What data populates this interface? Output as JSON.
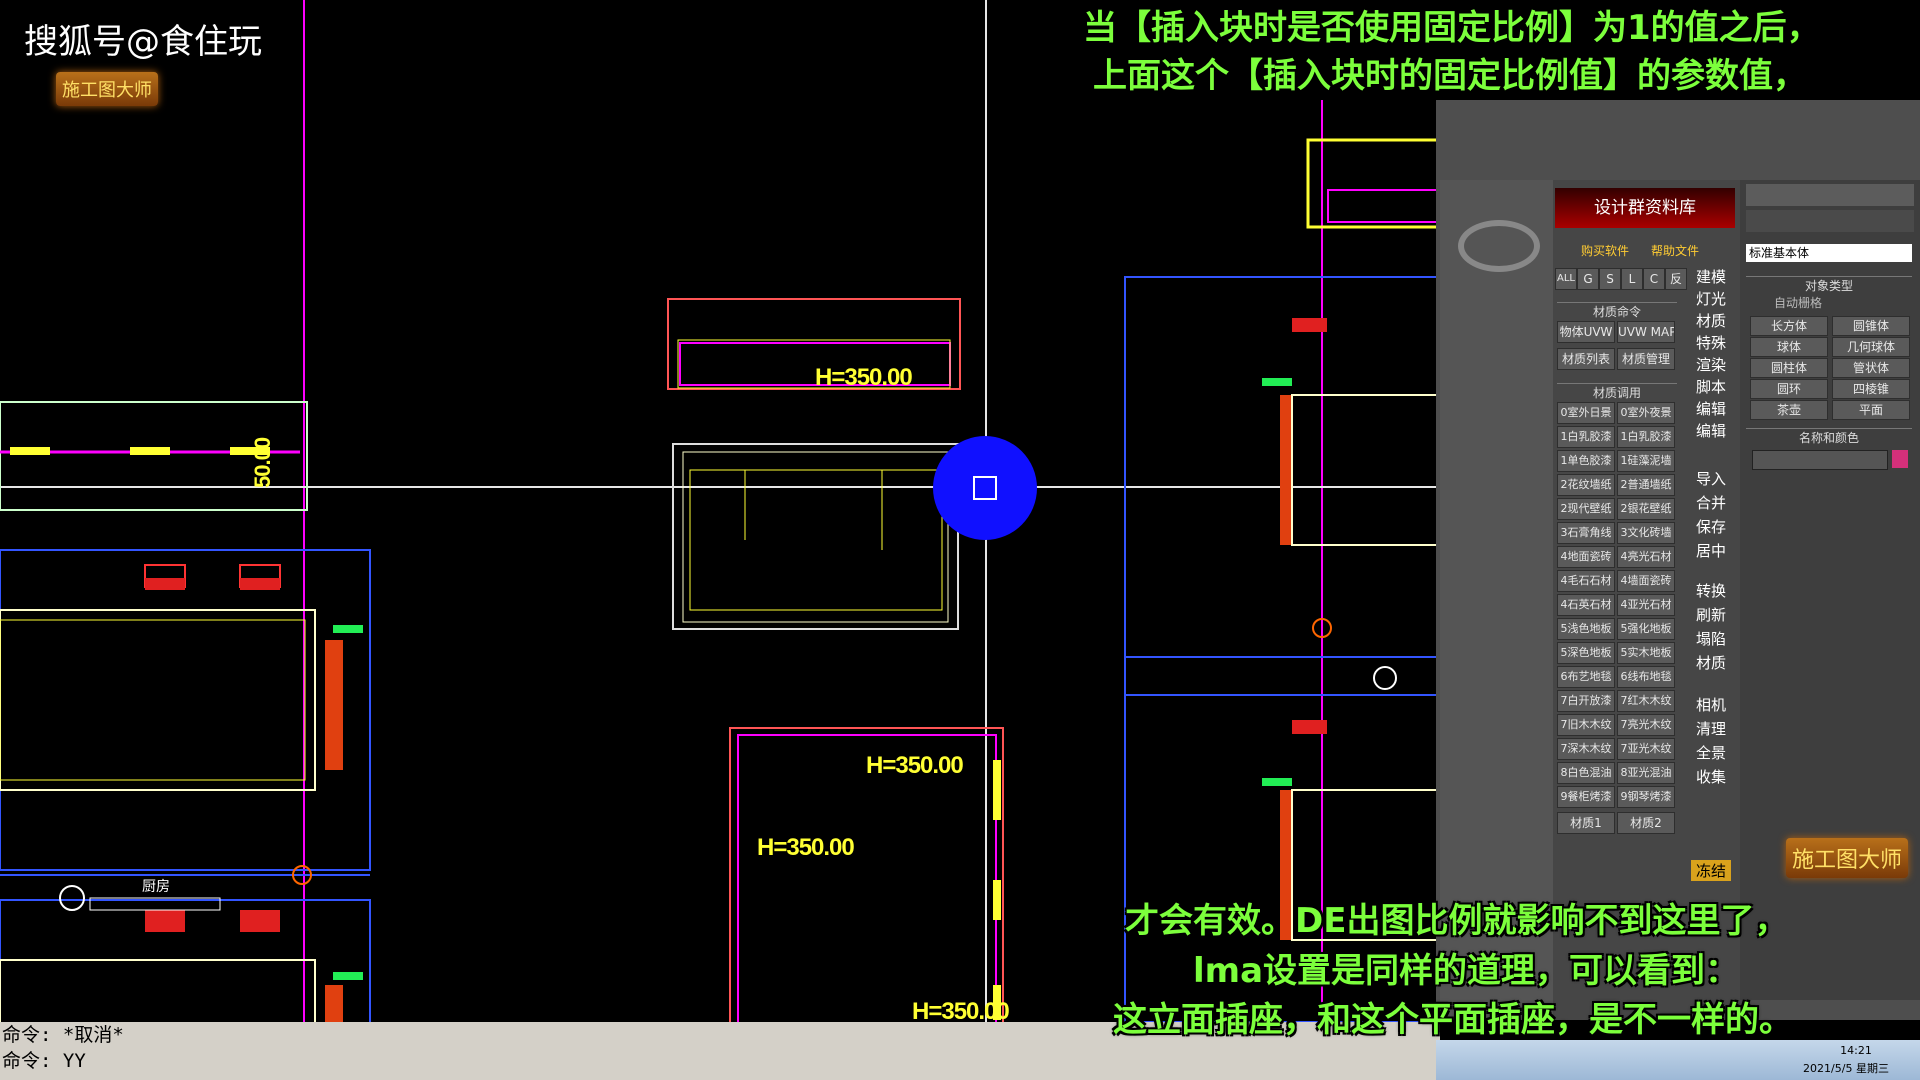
{
  "watermark": {
    "site": "搜狐号@食住玩",
    "badge": "施工图大师",
    "badge2": "施工图大师"
  },
  "subtitles": {
    "top_line1": "当【插入块时是否使用固定比例】为1的值之后，",
    "top_line2": "上面这个【插入块时的固定比例值】的参数值，",
    "bottom_line1": "才会有效。DE出图比例就影响不到这里了，",
    "bottom_line2": "lma设置是同样的道理，可以看到：",
    "bottom_line3": "这立面插座，和这个平面插座，是不一样的。"
  },
  "cad": {
    "labels": [
      "H=350.00",
      "H=350.00",
      "H=350.00",
      "H=350.00"
    ],
    "dim_vertical": "50.00",
    "room_label": "厨房"
  },
  "command_line": {
    "line1": "命令: *取消*",
    "line2": "命令: YY"
  },
  "plugin": {
    "title": "设计群资料库",
    "buy": "购买软件",
    "help": "帮助文件",
    "filters": [
      "ALL",
      "G",
      "S",
      "L",
      "C",
      "反"
    ],
    "group1": "材质命令",
    "group1_buttons": [
      "物体UVW",
      "UVW MAP",
      "材质列表",
      "材质管理"
    ],
    "group2": "材质调用",
    "materials": [
      [
        "0室外日景",
        "0室外夜景"
      ],
      [
        "1白乳胶漆",
        "1白乳胶漆"
      ],
      [
        "1单色胶漆",
        "1硅藻泥墙"
      ],
      [
        "2花纹墙纸",
        "2普通墙纸"
      ],
      [
        "2现代壁纸",
        "2银花壁纸"
      ],
      [
        "3石膏角线",
        "3文化砖墙"
      ],
      [
        "4地面瓷砖",
        "4亮光石材"
      ],
      [
        "4毛石石材",
        "4墙面瓷砖"
      ],
      [
        "4石英石材",
        "4亚光石材"
      ],
      [
        "5浅色地板",
        "5强化地板"
      ],
      [
        "5深色地板",
        "5实木地板"
      ],
      [
        "6布艺地毯",
        "6线布地毯"
      ],
      [
        "7白开放漆",
        "7红木木纹"
      ],
      [
        "7旧木木纹",
        "7亮光木纹"
      ],
      [
        "7深木木纹",
        "7亚光木纹"
      ],
      [
        "8白色混油",
        "8亚光混油"
      ],
      [
        "9餐柜烤漆",
        "9钢琴烤漆"
      ]
    ],
    "bottom_buttons": [
      "材质1",
      "材质2"
    ],
    "side_labels": [
      "建模",
      "灯光",
      "材质",
      "特殊",
      "渲染",
      "脚本",
      "编辑",
      "编辑",
      "导入",
      "合并",
      "保存",
      "居中",
      "转换",
      "刷新",
      "塌陷",
      "材质",
      "相机",
      "清理",
      "全景",
      "收集",
      "冻结"
    ]
  },
  "command_panel": {
    "dropdown": "标准基本体",
    "rollout1": "对象类型",
    "autogrid": "自动栅格",
    "objects": [
      [
        "长方体",
        "圆锥体"
      ],
      [
        "球体",
        "几何球体"
      ],
      [
        "圆柱体",
        "管状体"
      ],
      [
        "圆环",
        "四棱锥"
      ],
      [
        "茶壶",
        "平面"
      ]
    ],
    "rollout2": "名称和颜色",
    "color": "#d4307a"
  },
  "taskbar": {
    "time": "14:21",
    "date": "2021/5/5 星期三"
  },
  "colors": {
    "cad_yellow": "#ffff33",
    "cad_magenta": "#ff00ff",
    "cad_blue": "#3355ff",
    "subtitle_green": "#7cff3c",
    "cursor_blue": "#1010ff"
  }
}
